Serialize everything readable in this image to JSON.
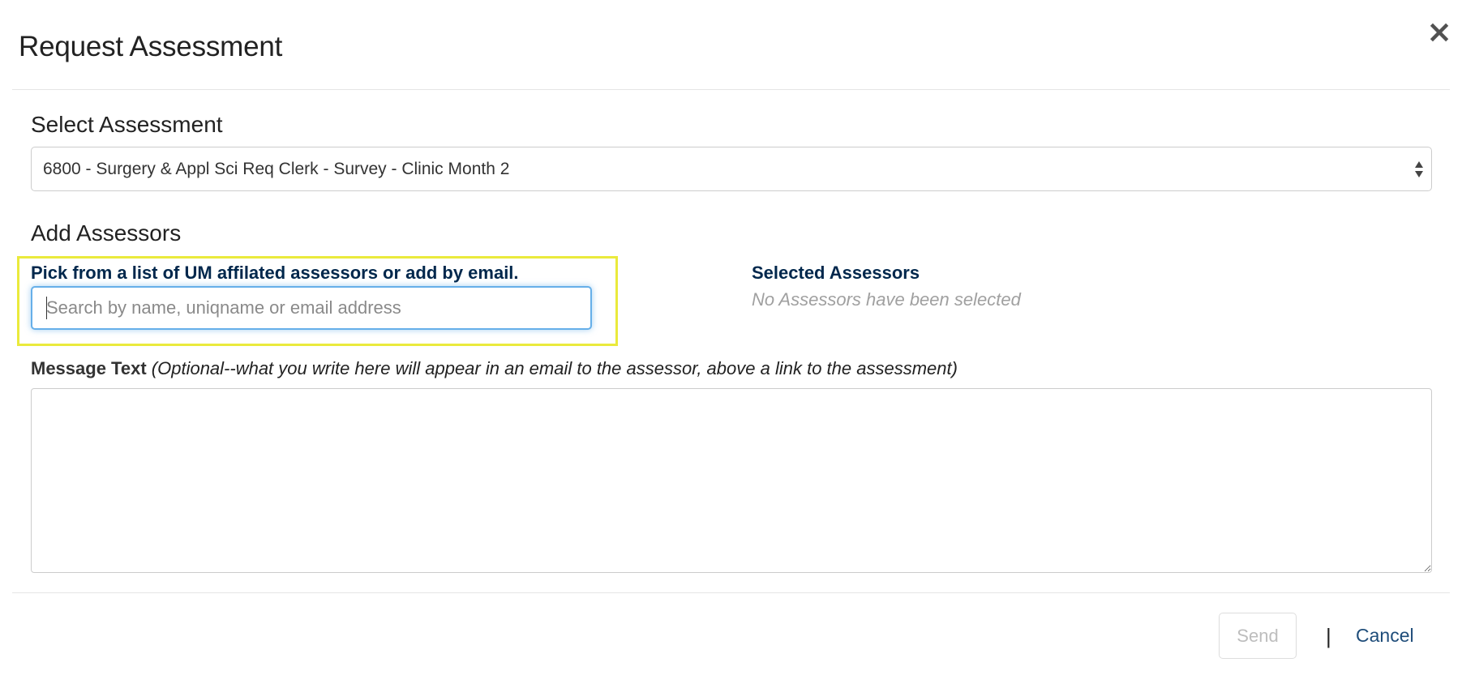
{
  "modal": {
    "title": "Request Assessment",
    "close_label": "×"
  },
  "assessment": {
    "heading": "Select Assessment",
    "selected": "6800 - Surgery & Appl Sci Req Clerk - Survey - Clinic Month 2"
  },
  "assessors": {
    "heading": "Add Assessors",
    "pick_label": "Pick from a list of UM affilated assessors or add by email.",
    "search_placeholder": "Search by name, uniqname or email address",
    "selected_heading": "Selected Assessors",
    "selected_empty": "No Assessors have been selected"
  },
  "message": {
    "label": "Message Text",
    "hint": "(Optional--what you write here will appear in an email to the assessor, above a link to the assessment)",
    "value": ""
  },
  "footer": {
    "send_label": "Send",
    "divider": "|",
    "cancel_label": "Cancel"
  },
  "colors": {
    "heading_navy": "#00274c",
    "link_blue": "#1f4d7a",
    "focus_blue": "#66afe9",
    "highlight_yellow": "#eaea3c",
    "muted_gray": "#a0a0a0"
  },
  "icons": {
    "close": "close-icon",
    "select_arrows": "sort-arrows-icon"
  }
}
